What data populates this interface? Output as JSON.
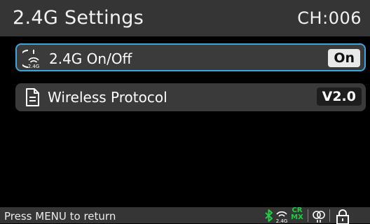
{
  "header": {
    "title": "2.4G Settings",
    "channel": "CH:006"
  },
  "menu": {
    "items": [
      {
        "label": "2.4G On/Off",
        "value": "On",
        "icon": "wireless-24g-icon",
        "icon_text": "2.4G",
        "selected": true
      },
      {
        "label": "Wireless Protocol",
        "value": "V2.0",
        "icon": "document-icon",
        "selected": false
      }
    ]
  },
  "footer": {
    "hint": "Press MENU to return",
    "status": {
      "wireless_label": "2.4G",
      "mode_top": "CR",
      "mode_bottom": "MX",
      "icons": [
        "bluetooth-icon",
        "wireless-24g-icon",
        "mode-icon",
        "link-icon",
        "lock-icon"
      ]
    }
  },
  "colors": {
    "header_bg": "#353535",
    "selection_border": "#3aa6e0",
    "bluetooth": "#22cc44",
    "mode": "#22cc44"
  }
}
